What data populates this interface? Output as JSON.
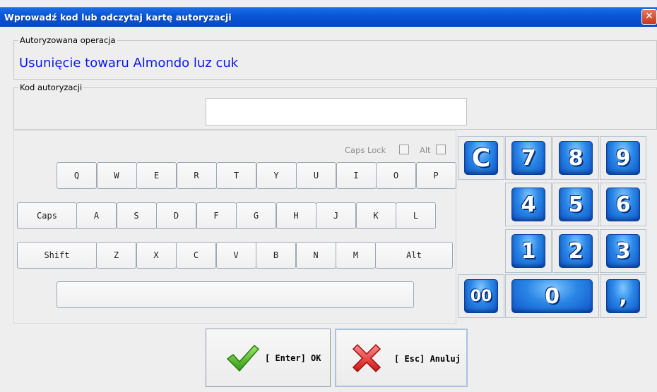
{
  "window": {
    "title": "Wprowadź kod lub odczytaj kartę autoryzacji",
    "close_glyph": "✕"
  },
  "operation_group": {
    "label": "Autoryzowana operacja",
    "value": "Usunięcie towaru Almondo luz cuk",
    "value_color": "#0b1cdd"
  },
  "code_group": {
    "label": "Kod autoryzacji",
    "input_value": ""
  },
  "options": {
    "caps_lock_label": "Caps Lock",
    "caps_lock_checked": false,
    "alt_label": "Alt",
    "alt_checked": false
  },
  "keyboard": {
    "row1": [
      "Q",
      "W",
      "E",
      "R",
      "T",
      "Y",
      "U",
      "I",
      "O",
      "P"
    ],
    "row2": [
      "Caps",
      "A",
      "S",
      "D",
      "F",
      "G",
      "H",
      "J",
      "K",
      "L"
    ],
    "row3": [
      "Shift",
      "Z",
      "X",
      "C",
      "V",
      "B",
      "N",
      "M",
      "Alt"
    ],
    "space": ""
  },
  "numpad": {
    "clear": "C",
    "keys": [
      "7",
      "8",
      "9",
      "4",
      "5",
      "6",
      "1",
      "2",
      "3"
    ],
    "double_zero": "00",
    "zero": "0",
    "comma": ",",
    "accent_color": "#1f78e0"
  },
  "buttons": {
    "ok_label": "[ Enter] OK",
    "ok_icon": "check-icon",
    "cancel_label": "[ Esc] Anuluj",
    "cancel_icon": "x-icon"
  }
}
